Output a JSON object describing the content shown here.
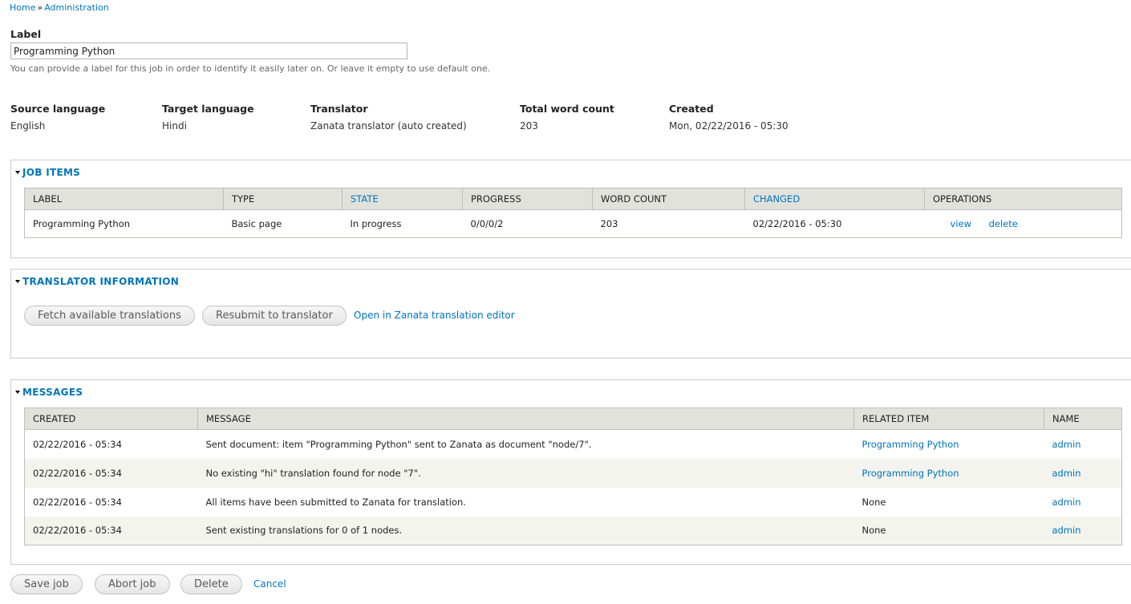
{
  "breadcrumb": {
    "home": "Home",
    "sep": "»",
    "admin": "Administration"
  },
  "label": {
    "title": "Label",
    "value": "Programming Python",
    "description": "You can provide a label for this job in order to identify it easily later on. Or leave it empty to use default one."
  },
  "info": {
    "source_h": "Source language",
    "source_v": "English",
    "target_h": "Target language",
    "target_v": "Hindi",
    "translator_h": "Translator",
    "translator_v": "Zanata translator (auto created)",
    "wordcount_h": "Total word count",
    "wordcount_v": "203",
    "created_h": "Created",
    "created_v": "Mon, 02/22/2016 - 05:30"
  },
  "job_items": {
    "legend": "Job items",
    "headers": {
      "label": "Label",
      "type": "Type",
      "state": "State",
      "progress": "Progress",
      "word_count": "Word count",
      "changed": "Changed",
      "operations": "Operations"
    },
    "rows": [
      {
        "label": "Programming Python",
        "type": "Basic page",
        "state": "In progress",
        "progress": "0/0/0/2",
        "word_count": "203",
        "changed": "02/22/2016 - 05:30",
        "op_view": "view",
        "op_delete": "delete"
      }
    ]
  },
  "translator_info": {
    "legend": "Translator information",
    "fetch": "Fetch available translations",
    "resubmit": "Resubmit to translator",
    "open_link": "Open in Zanata translation editor"
  },
  "messages": {
    "legend": "Messages",
    "headers": {
      "created": "Created",
      "message": "Message",
      "related": "Related item",
      "name": "Name"
    },
    "rows": [
      {
        "created": "02/22/2016 - 05:34",
        "message": "Sent document: item \"Programming Python\" sent to Zanata as document \"node/7\".",
        "related": "Programming Python",
        "name": "admin"
      },
      {
        "created": "02/22/2016 - 05:34",
        "message": "No existing \"hi\" translation found for node \"7\".",
        "related": "Programming Python",
        "name": "admin"
      },
      {
        "created": "02/22/2016 - 05:34",
        "message": "All items have been submitted to Zanata for translation.",
        "related": "None",
        "name": "admin"
      },
      {
        "created": "02/22/2016 - 05:34",
        "message": "Sent existing translations for 0 of 1 nodes.",
        "related": "None",
        "name": "admin"
      }
    ]
  },
  "actions": {
    "save": "Save job",
    "abort": "Abort job",
    "delete": "Delete",
    "cancel": "Cancel"
  },
  "colors": {
    "link": "#0074bd",
    "header_bg": "#e1e2dc",
    "zebra": "#f3f4ee"
  }
}
